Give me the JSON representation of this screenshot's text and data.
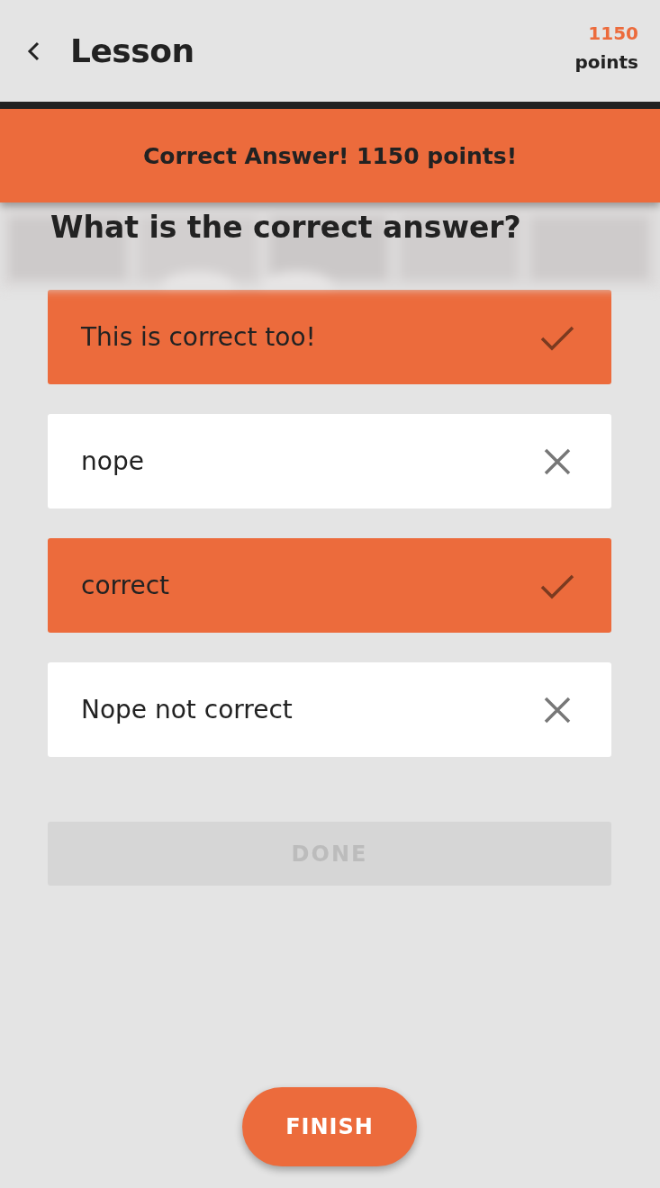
{
  "header": {
    "title": "Lesson",
    "score": "1150",
    "score_label": "points"
  },
  "banner": {
    "text": "Correct Answer! 1150 points!"
  },
  "question": {
    "text": "What is the correct answer?"
  },
  "answers": [
    {
      "text": "This is correct too!",
      "correct": true
    },
    {
      "text": "nope",
      "correct": false
    },
    {
      "text": "correct",
      "correct": true
    },
    {
      "text": "Nope not correct",
      "correct": false
    }
  ],
  "done_button": {
    "label": "DONE",
    "disabled": true
  },
  "finish_button": {
    "label": "FINISH"
  }
}
